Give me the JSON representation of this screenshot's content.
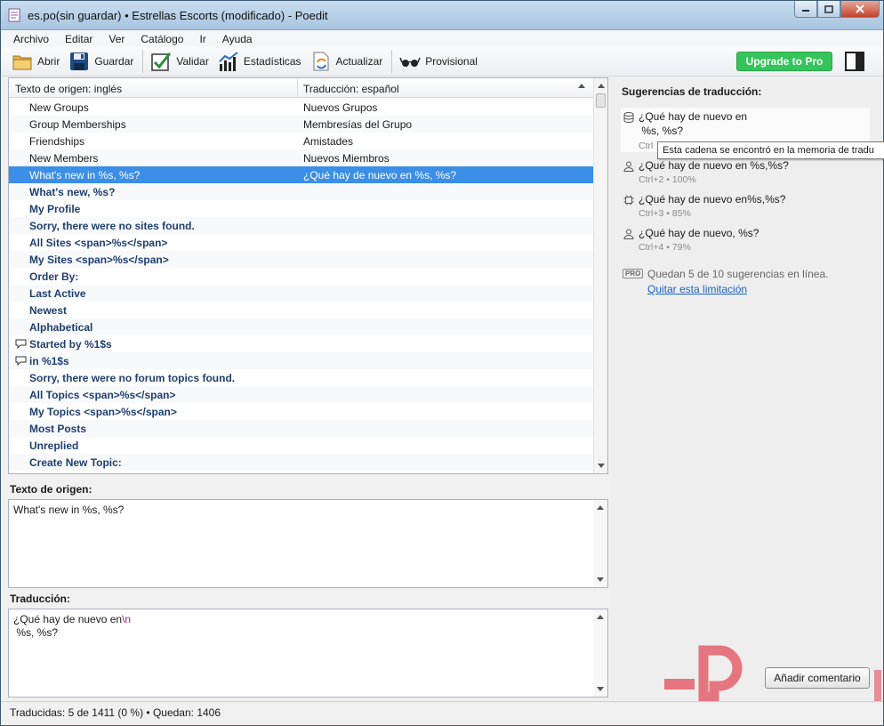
{
  "window": {
    "title": "es.po(sin guardar) • Estrellas Escorts (modificado) - Poedit"
  },
  "menu": [
    "Archivo",
    "Editar",
    "Ver",
    "Catálogo",
    "Ir",
    "Ayuda"
  ],
  "toolbar": {
    "open": "Abrir",
    "save": "Guardar",
    "validate": "Validar",
    "stats": "Estadísticas",
    "update": "Actualizar",
    "fuzzy": "Provisional",
    "upgrade": "Upgrade to Pro"
  },
  "list": {
    "col_source": "Texto de origen: inglés",
    "col_translation": "Traducción: español",
    "rows": [
      {
        "src": "New Groups",
        "dst": "Nuevos Grupos",
        "state": "translated",
        "comment": false
      },
      {
        "src": "Group Memberships",
        "dst": "Membresías del Grupo",
        "state": "translated",
        "comment": false
      },
      {
        "src": "Friendships",
        "dst": "Amistades",
        "state": "translated",
        "comment": false
      },
      {
        "src": "New Members",
        "dst": "Nuevos Miembros",
        "state": "translated",
        "comment": false
      },
      {
        "src": "What's new in %s, %s?",
        "dst": "¿Qué hay de nuevo en %s, %s?",
        "state": "selected",
        "comment": false
      },
      {
        "src": "What's new, %s?",
        "dst": "",
        "state": "untranslated",
        "comment": false
      },
      {
        "src": "My Profile",
        "dst": "",
        "state": "untranslated",
        "comment": false
      },
      {
        "src": "Sorry, there were no sites found.",
        "dst": "",
        "state": "untranslated",
        "comment": false
      },
      {
        "src": "All Sites <span>%s</span>",
        "dst": "",
        "state": "untranslated",
        "comment": false
      },
      {
        "src": "My Sites <span>%s</span>",
        "dst": "",
        "state": "untranslated",
        "comment": false
      },
      {
        "src": "Order By:",
        "dst": "",
        "state": "untranslated",
        "comment": false
      },
      {
        "src": "Last Active",
        "dst": "",
        "state": "untranslated",
        "comment": false
      },
      {
        "src": "Newest",
        "dst": "",
        "state": "untranslated",
        "comment": false
      },
      {
        "src": "Alphabetical",
        "dst": "",
        "state": "untranslated",
        "comment": false
      },
      {
        "src": "Started by %1$s",
        "dst": "",
        "state": "untranslated",
        "comment": true
      },
      {
        "src": "in %1$s",
        "dst": "",
        "state": "untranslated",
        "comment": true
      },
      {
        "src": "Sorry, there were no forum topics found.",
        "dst": "",
        "state": "untranslated",
        "comment": false
      },
      {
        "src": "All Topics <span>%s</span>",
        "dst": "",
        "state": "untranslated",
        "comment": false
      },
      {
        "src": "My Topics <span>%s</span>",
        "dst": "",
        "state": "untranslated",
        "comment": false
      },
      {
        "src": "Most Posts",
        "dst": "",
        "state": "untranslated",
        "comment": false
      },
      {
        "src": "Unreplied",
        "dst": "",
        "state": "untranslated",
        "comment": false
      },
      {
        "src": "Create New Topic:",
        "dst": "",
        "state": "untranslated",
        "comment": false
      }
    ]
  },
  "source_editor": {
    "label": "Texto de origen:",
    "text": "What's new in %s, %s?"
  },
  "translation_editor": {
    "label": "Traducción:",
    "line1": "¿Qué hay de nuevo en",
    "newline_marker": "\\n",
    "line2": " %s, %s?"
  },
  "status": {
    "text": "Traducidas: 5 de 1411 (0 %)  •  Quedan: 1406"
  },
  "suggestions": {
    "title": "Sugerencias de traducción:",
    "items": [
      {
        "text": "¿Qué hay de nuevo en\n %s, %s?",
        "meta": "Ctrl",
        "icon": "database-icon"
      },
      {
        "text": "¿Qué hay de nuevo en %s,%s?",
        "meta": "Ctrl+2 • 100%",
        "icon": "person-icon"
      },
      {
        "text": "¿Qué hay de nuevo en%s,%s?",
        "meta": "Ctrl+3 • 85%",
        "icon": "machine-icon"
      },
      {
        "text": "¿Qué hay de nuevo, %s?",
        "meta": "Ctrl+4 • 79%",
        "icon": "person-icon"
      }
    ],
    "tooltip": "Esta cadena se encontró en la memoria de tradu",
    "pro_badge": "PRO",
    "pro_text": "Quedan 5 de 10 sugerencias en línea.",
    "pro_link": "Quitar esta limitación",
    "add_comment": "Añadir comentario"
  },
  "colors": {
    "selection": "#3c8ee6",
    "untranslated": "#1f3f70",
    "upgrade": "#35c45a",
    "link": "#1a63c2"
  }
}
